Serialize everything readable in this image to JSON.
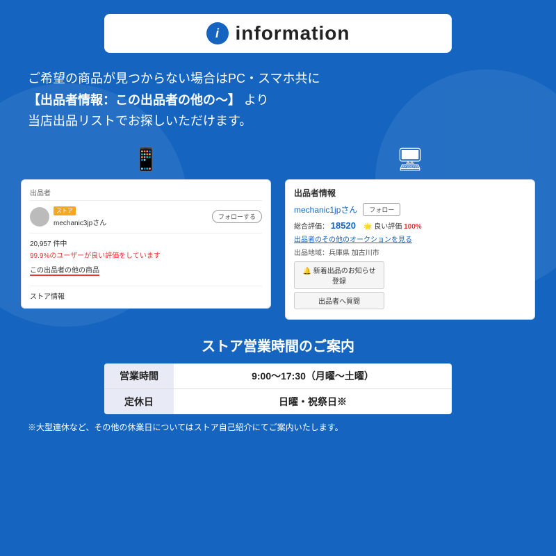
{
  "header": {
    "icon_label": "i",
    "title": "information"
  },
  "description": {
    "line1": "ご希望の商品が見つからない場合はPC・スマホ共に",
    "line2_highlight": "【出品者情報：この出品者の他の〜】",
    "line2_suffix": " より",
    "line3": "当店出品リストでお探しいただけます。"
  },
  "mobile_card": {
    "section_label": "出品者",
    "store_badge": "ストア",
    "seller_name": "mechanic3jpさん",
    "follow_btn": "フォローする",
    "stats": "20,957 件中",
    "rating": "99.9%のユーザーが良い評価をしています",
    "other_items_link": "この出品者の他の商品",
    "store_info": "ストア情報"
  },
  "pc_card": {
    "section_title": "出品者情報",
    "seller_name": "mechanic1jpさん",
    "follow_btn": "フォロー",
    "rating_label": "総合評価：",
    "rating_num": "18520",
    "good_label": "🌟 良い評価",
    "good_value": "100%",
    "auction_link": "出品者のその他のオークションを見る",
    "location_label": "出品地域：兵庫県 加古川市",
    "notify_btn": "🔔 新着出品のお知らせ登録",
    "question_btn": "出品者へ質問"
  },
  "business": {
    "title": "ストア営業時間のご案内",
    "rows": [
      {
        "label": "営業時間",
        "value": "9:00〜17:30（月曜〜土曜）"
      },
      {
        "label": "定休日",
        "value": "日曜・祝祭日※"
      }
    ],
    "footnote": "※大型連休など、その他の休業日についてはストア自己紹介にてご案内いたします。"
  },
  "colors": {
    "bg": "#1565c0",
    "white": "#ffffff",
    "accent_red": "#e53935",
    "accent_blue": "#1565c0"
  }
}
